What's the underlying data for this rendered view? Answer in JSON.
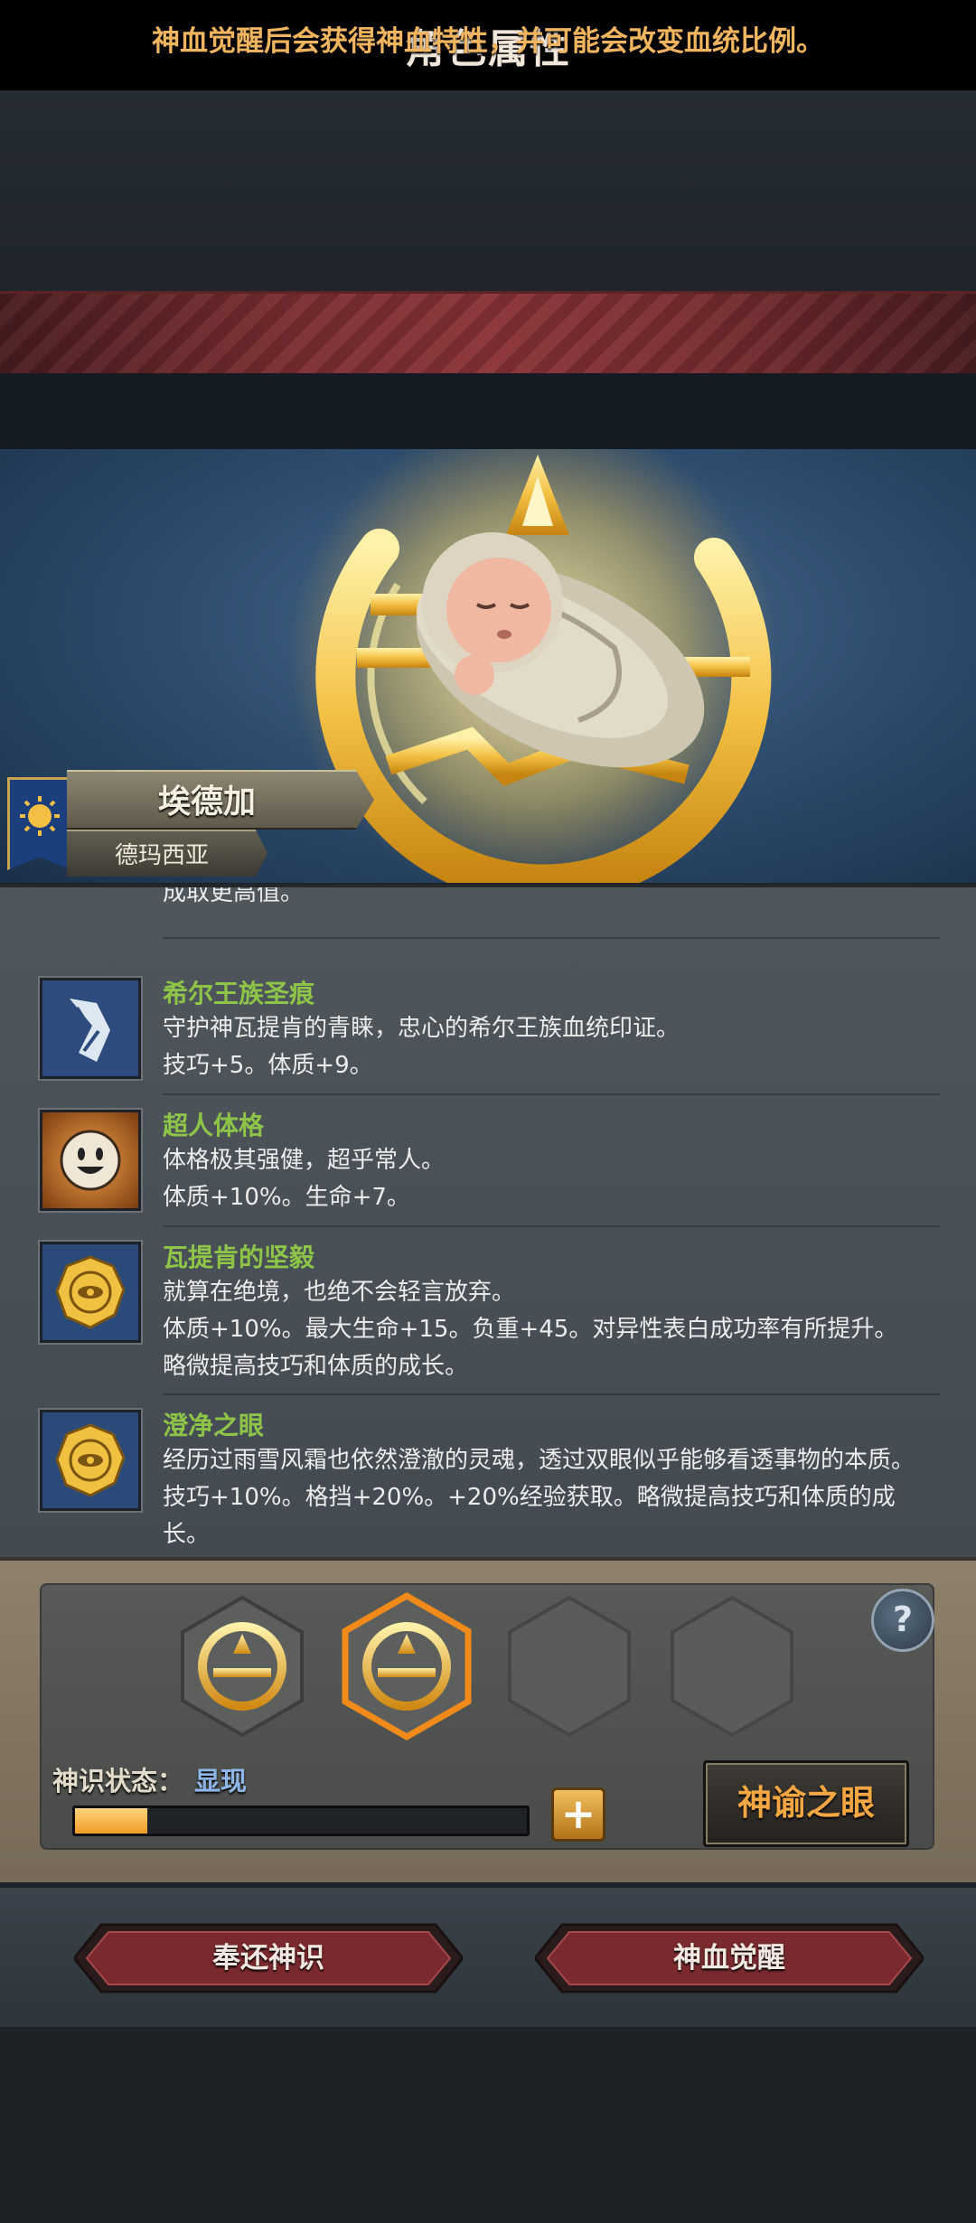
{
  "screen": {
    "title": "角色属性",
    "notice": "神血觉醒后会获得神血特性，并可能会改变血统比例。"
  },
  "character": {
    "name": "埃德加",
    "house": "德玛西亚",
    "portrait": "swaddled-baby"
  },
  "traits": {
    "cut_off_text": "成取更高值。",
    "items": [
      {
        "icon": "royal-scar-icon",
        "name": "希尔王族圣痕",
        "desc": "守护神瓦提肯的青睐，忠心的希尔王族血统印证。\n技巧+5。体质+9。"
      },
      {
        "icon": "smiley-face-icon",
        "name": "超人体格",
        "desc": "体格极其强健，超乎常人。\n体质+10%。生命+7。"
      },
      {
        "icon": "eye-medallion-icon",
        "name": "瓦提肯的坚毅",
        "desc": "就算在绝境，也绝不会轻言放弃。\n体质+10%。最大生命+15。负重+45。对异性表白成功率有所提升。\n略微提高技巧和体质的成长。"
      },
      {
        "icon": "eye-medallion-icon",
        "name": "澄净之眼",
        "desc": "经历过雨雪风霜也依然澄澈的灵魂，透过双眼似乎能够看透事物的本质。\n技巧+10%。格挡+20%。+20%经验获取。略微提高技巧和体质的成\n长。"
      }
    ]
  },
  "divine": {
    "status_label": "神识状态：",
    "status_value": "显现",
    "progress": 0.16,
    "slots": [
      "filled",
      "filled-selected",
      "empty",
      "empty"
    ],
    "eye_button": "神谕之眼",
    "plus_label": "+",
    "help_label": "?"
  },
  "actions": {
    "return": "奉还神识",
    "awaken": "神血觉醒"
  },
  "colors": {
    "accent_gold": "#f4a642",
    "trait_name_green": "#8ec549",
    "banner_red": "#7c2e32"
  }
}
